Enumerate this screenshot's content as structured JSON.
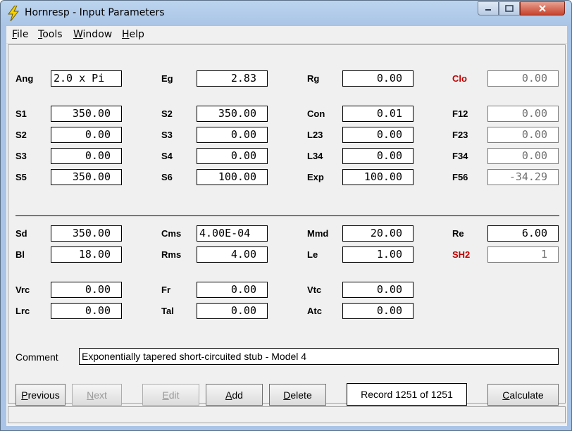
{
  "window": {
    "title": "Hornresp - Input Parameters"
  },
  "menu": [
    "File",
    "Tools",
    "Window",
    "Help"
  ],
  "fields": {
    "ang": {
      "label": "Ang",
      "value": "2.0 x Pi"
    },
    "eg": {
      "label": "Eg",
      "value": "2.83"
    },
    "rg": {
      "label": "Rg",
      "value": "0.00"
    },
    "clo": {
      "label": "Clo",
      "value": "0.00"
    },
    "s1": {
      "label": "S1",
      "value": "350.00"
    },
    "s2a": {
      "label": "S2",
      "value": "350.00"
    },
    "con": {
      "label": "Con",
      "value": "0.01"
    },
    "f12": {
      "label": "F12",
      "value": "0.00"
    },
    "s2b": {
      "label": "S2",
      "value": "0.00"
    },
    "s3a": {
      "label": "S3",
      "value": "0.00"
    },
    "l23": {
      "label": "L23",
      "value": "0.00"
    },
    "f23": {
      "label": "F23",
      "value": "0.00"
    },
    "s3b": {
      "label": "S3",
      "value": "0.00"
    },
    "s4": {
      "label": "S4",
      "value": "0.00"
    },
    "l34": {
      "label": "L34",
      "value": "0.00"
    },
    "f34": {
      "label": "F34",
      "value": "0.00"
    },
    "s5": {
      "label": "S5",
      "value": "350.00"
    },
    "s6": {
      "label": "S6",
      "value": "100.00"
    },
    "exp": {
      "label": "Exp",
      "value": "100.00"
    },
    "f56": {
      "label": "F56",
      "value": "-34.29"
    },
    "sd": {
      "label": "Sd",
      "value": "350.00"
    },
    "cms": {
      "label": "Cms",
      "value": "4.00E-04"
    },
    "mmd": {
      "label": "Mmd",
      "value": "20.00"
    },
    "re": {
      "label": "Re",
      "value": "6.00"
    },
    "bl": {
      "label": "Bl",
      "value": "18.00"
    },
    "rms": {
      "label": "Rms",
      "value": "4.00"
    },
    "le": {
      "label": "Le",
      "value": "1.00"
    },
    "sh2": {
      "label": "SH2",
      "value": "1"
    },
    "vrc": {
      "label": "Vrc",
      "value": "0.00"
    },
    "fr": {
      "label": "Fr",
      "value": "0.00"
    },
    "vtc": {
      "label": "Vtc",
      "value": "0.00"
    },
    "lrc": {
      "label": "Lrc",
      "value": "0.00"
    },
    "tal": {
      "label": "Tal",
      "value": "0.00"
    },
    "atc": {
      "label": "Atc",
      "value": "0.00"
    }
  },
  "comment": {
    "label": "Comment",
    "value": "Exponentially tapered short-circuited stub - Model 4"
  },
  "buttons": {
    "previous": "Previous",
    "next": "Next",
    "edit": "Edit",
    "add": "Add",
    "delete": "Delete",
    "calculate": "Calculate"
  },
  "record": "Record 1251 of 1251",
  "colors": {
    "highlight_label": "#c00000"
  },
  "icons": {
    "app": "lightning-bolt-icon"
  }
}
